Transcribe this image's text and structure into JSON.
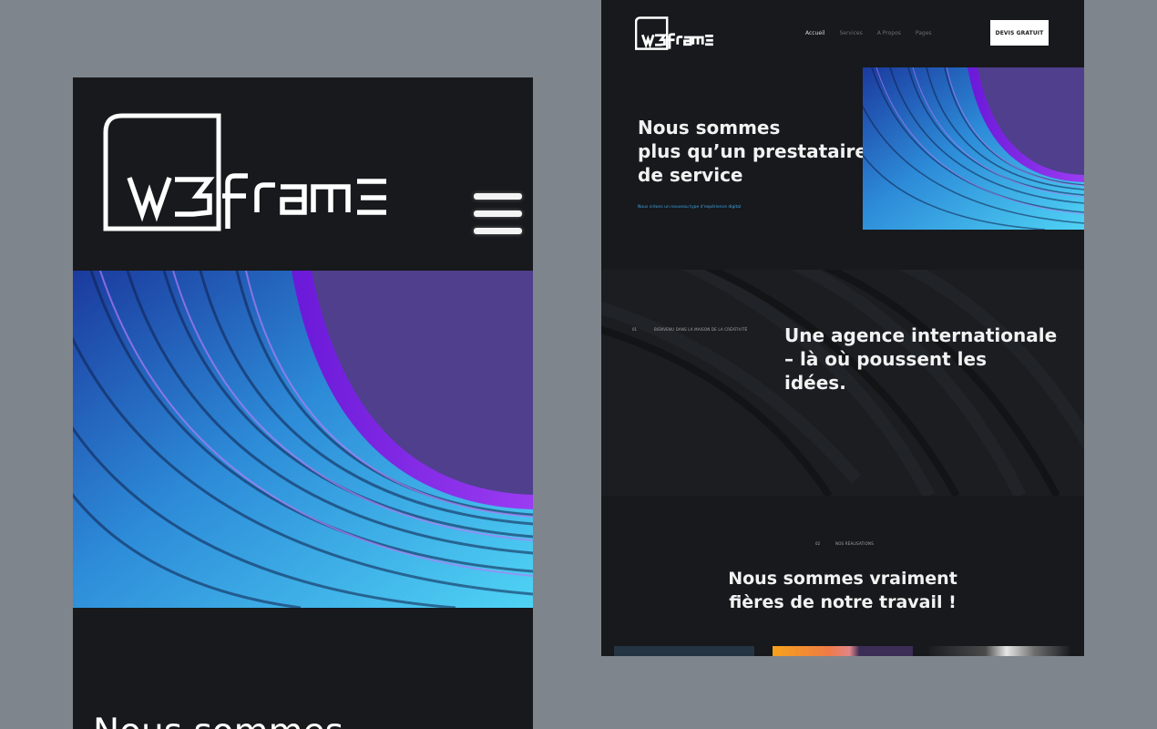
{
  "colors": {
    "page_background": "#7f858c",
    "panel_background": "#17191c",
    "text_primary": "#f2f2f2",
    "accent_blue": "#3ea6e6",
    "accent_purple": "#8a2be2"
  },
  "mobile": {
    "logo_alt": "W3frame logo",
    "menu_icon": "hamburger-menu-icon",
    "hero_title": "Nous sommes"
  },
  "desktop": {
    "logo_alt": "W3frame logo",
    "nav": {
      "items": [
        "Accueil",
        "Services",
        "A Propos",
        "Pages"
      ],
      "active": "Accueil"
    },
    "cta_label": "DEVIS GRATUIT",
    "hero": {
      "title_lines": [
        "Nous sommes",
        "plus qu’un prestataire",
        "de service"
      ],
      "subtitle": "Nous créons un nouveau type d’expérience digital"
    },
    "section2": {
      "number": "01",
      "label": "BIENVENU DANS LA MAISON DE LA CRÉATIVITÉ",
      "title_lines": [
        "Une agence internationale",
        "– là où poussent les",
        "idées."
      ]
    },
    "section3": {
      "number": "02",
      "label": "NOS RÉALISATIONS",
      "title_lines": [
        "Nous sommes vraiment",
        "fières de notre travail !"
      ]
    }
  }
}
